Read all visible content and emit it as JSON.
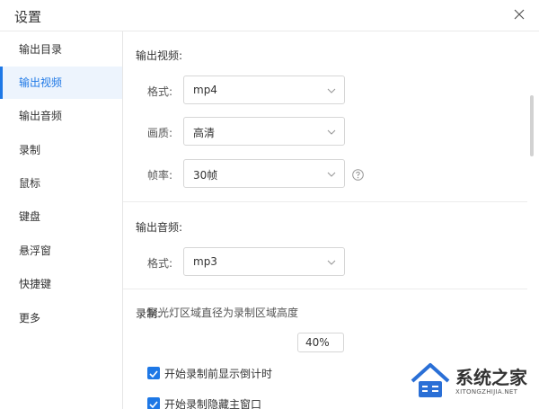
{
  "window": {
    "title": "设置"
  },
  "sidebar": {
    "items": [
      {
        "label": "输出目录",
        "active": false
      },
      {
        "label": "输出视频",
        "active": true
      },
      {
        "label": "输出音频",
        "active": false
      },
      {
        "label": "录制",
        "active": false
      },
      {
        "label": "鼠标",
        "active": false
      },
      {
        "label": "键盘",
        "active": false
      },
      {
        "label": "悬浮窗",
        "active": false
      },
      {
        "label": "快捷键",
        "active": false
      },
      {
        "label": "更多",
        "active": false
      }
    ]
  },
  "video": {
    "title": "输出视频:",
    "format_label": "格式:",
    "format_value": "mp4",
    "quality_label": "画质:",
    "quality_value": "高清",
    "fps_label": "帧率:",
    "fps_value": "30帧"
  },
  "audio": {
    "title": "输出音频:",
    "format_label": "格式:",
    "format_value": "mp3"
  },
  "record": {
    "title": "录制:",
    "spotlight_label": "聚光灯区域直径为录制区域高度",
    "spotlight_value": "40%",
    "countdown_label": "开始录制前显示倒计时",
    "countdown_checked": true,
    "hide_window_label": "开始录制隐藏主窗口",
    "hide_window_checked": true
  },
  "watermark": {
    "name": "系统之家",
    "url": "XITONGZHIJIA.NET"
  },
  "colors": {
    "accent": "#1e78e6",
    "active_bg": "#edf4fd",
    "border": "#d6d6d6"
  },
  "icons": {
    "close": "close-icon",
    "chevron": "chevron-down-icon",
    "help": "help-circle-icon",
    "check": "check-icon"
  }
}
